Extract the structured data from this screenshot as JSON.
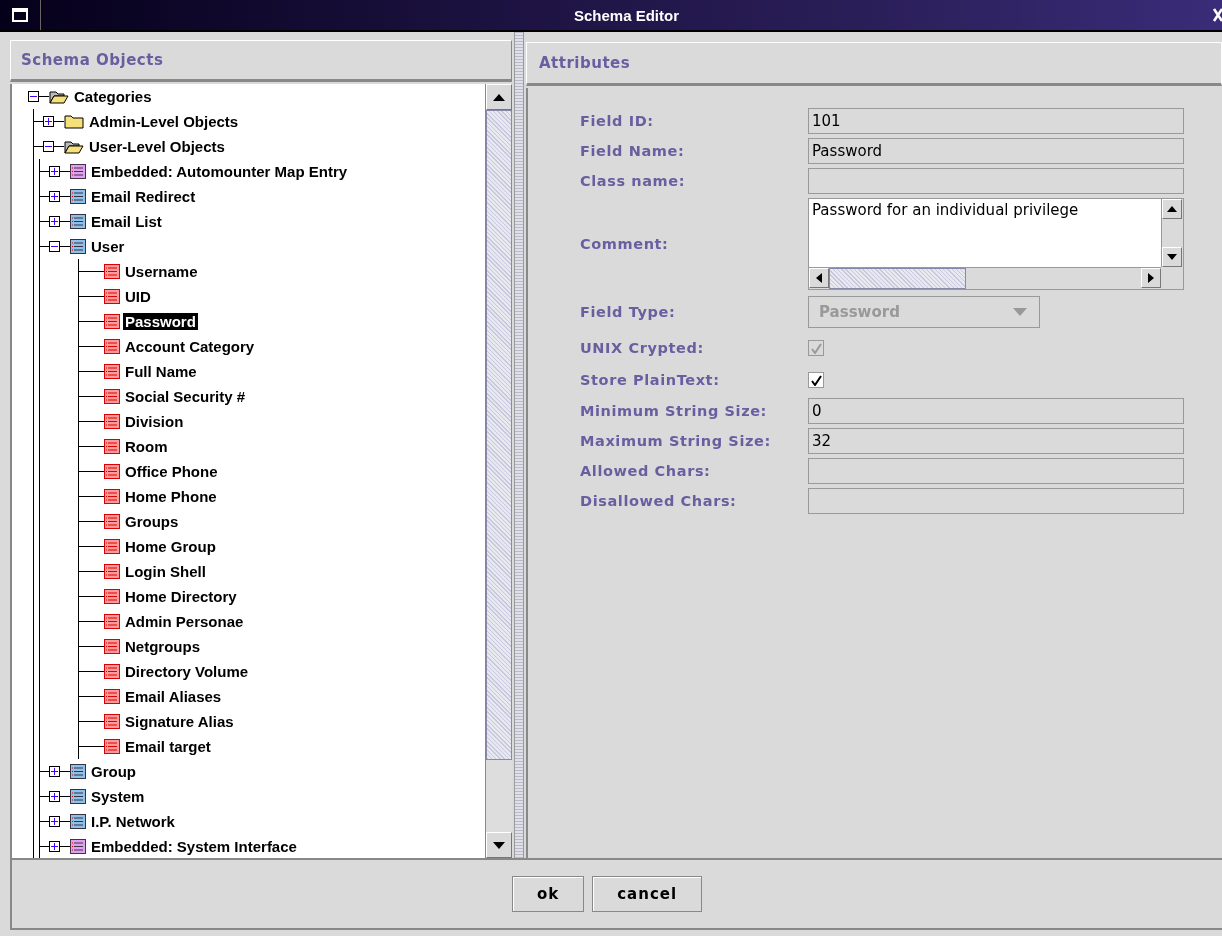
{
  "window": {
    "title": "Schema Editor"
  },
  "left_panel": {
    "title": "Schema Objects"
  },
  "tree": {
    "items": [
      {
        "label": "Categories",
        "kind": "folder",
        "expanded": true,
        "selected": false,
        "children": [
          {
            "label": "Admin-Level Objects",
            "kind": "folder",
            "expanded": false,
            "selected": false
          },
          {
            "label": "User-Level Objects",
            "kind": "folder",
            "expanded": true,
            "selected": false,
            "children": [
              {
                "label": "Embedded: Automounter Map Entry",
                "kind": "embedded",
                "expanded": false,
                "selected": false
              },
              {
                "label": "Email Redirect",
                "kind": "object",
                "expanded": false,
                "selected": false
              },
              {
                "label": "Email List",
                "kind": "object",
                "expanded": false,
                "selected": false
              },
              {
                "label": "User",
                "kind": "object",
                "expanded": true,
                "selected": false,
                "children": [
                  {
                    "label": "Username",
                    "kind": "field",
                    "selected": false
                  },
                  {
                    "label": "UID",
                    "kind": "field",
                    "selected": false
                  },
                  {
                    "label": "Password",
                    "kind": "field",
                    "selected": true
                  },
                  {
                    "label": "Account Category",
                    "kind": "field",
                    "selected": false
                  },
                  {
                    "label": "Full Name",
                    "kind": "field",
                    "selected": false
                  },
                  {
                    "label": "Social Security #",
                    "kind": "field",
                    "selected": false
                  },
                  {
                    "label": "Division",
                    "kind": "field",
                    "selected": false
                  },
                  {
                    "label": "Room",
                    "kind": "field",
                    "selected": false
                  },
                  {
                    "label": "Office Phone",
                    "kind": "field",
                    "selected": false
                  },
                  {
                    "label": "Home Phone",
                    "kind": "field",
                    "selected": false
                  },
                  {
                    "label": "Groups",
                    "kind": "field",
                    "selected": false
                  },
                  {
                    "label": "Home Group",
                    "kind": "field",
                    "selected": false
                  },
                  {
                    "label": "Login Shell",
                    "kind": "field",
                    "selected": false
                  },
                  {
                    "label": "Home Directory",
                    "kind": "field",
                    "selected": false
                  },
                  {
                    "label": "Admin Personae",
                    "kind": "field",
                    "selected": false
                  },
                  {
                    "label": "Netgroups",
                    "kind": "field",
                    "selected": false
                  },
                  {
                    "label": "Directory Volume",
                    "kind": "field",
                    "selected": false
                  },
                  {
                    "label": "Email Aliases",
                    "kind": "field",
                    "selected": false
                  },
                  {
                    "label": "Signature Alias",
                    "kind": "field",
                    "selected": false
                  },
                  {
                    "label": "Email target",
                    "kind": "field",
                    "selected": false
                  }
                ]
              },
              {
                "label": "Group",
                "kind": "object",
                "expanded": false,
                "selected": false
              },
              {
                "label": "System",
                "kind": "object",
                "expanded": false,
                "selected": false
              },
              {
                "label": "I.P. Network",
                "kind": "object",
                "expanded": false,
                "selected": false
              },
              {
                "label": "Embedded: System Interface",
                "kind": "embedded",
                "expanded": false,
                "selected": false
              }
            ]
          }
        ]
      }
    ]
  },
  "right_panel": {
    "title": "Attributes"
  },
  "attributes": [
    {
      "kind": "text",
      "label": "Field ID:",
      "value": "101"
    },
    {
      "kind": "text",
      "label": "Field Name:",
      "value": "Password"
    },
    {
      "kind": "text",
      "label": "Class name:"
    },
    {
      "kind": "textarea",
      "label": "Comment:",
      "value": "Password for an individual privilege"
    },
    {
      "kind": "dropdown",
      "label": "Field Type:",
      "value": "Password",
      "disabled": true
    },
    {
      "kind": "checkbox",
      "label": "UNIX Crypted:",
      "checked": true,
      "disabled": true
    },
    {
      "kind": "checkbox",
      "label": "Store PlainText:",
      "checked": true,
      "disabled": false
    },
    {
      "kind": "text",
      "label": "Minimum String Size:",
      "value": "0"
    },
    {
      "kind": "text",
      "label": "Maximum String Size:",
      "value": "32"
    },
    {
      "kind": "text",
      "label": "Allowed Chars:"
    },
    {
      "kind": "text",
      "label": "Disallowed Chars:"
    }
  ],
  "buttons": [
    "ok",
    "cancel"
  ]
}
